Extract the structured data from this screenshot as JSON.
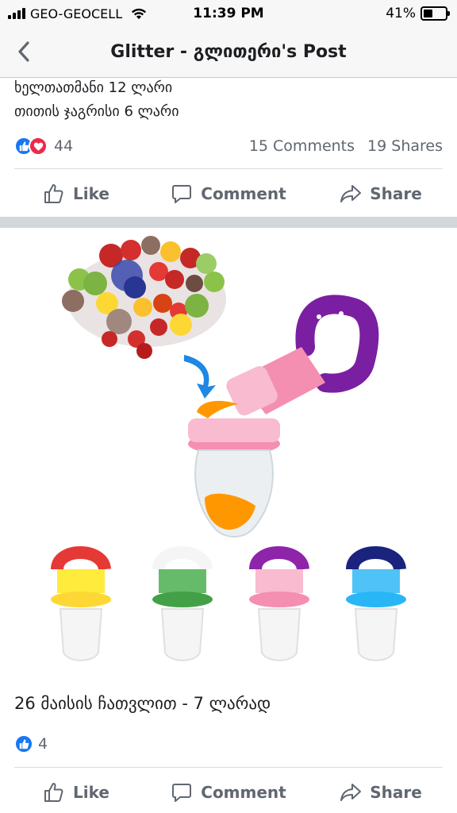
{
  "status_bar": {
    "carrier": "GEO-GEOCELL",
    "time": "11:39 PM",
    "battery_percent": "41%",
    "battery_level": 0.41
  },
  "nav": {
    "title": "Glitter - გლითერი's Post",
    "back_icon": "chevron-left-icon"
  },
  "post": {
    "text_lines": [
      "ხელთათმანი 12 ლარი",
      "თითის ჯაგრისი 6 ლარი"
    ],
    "reactions": {
      "icons": [
        "like-icon",
        "love-icon"
      ],
      "count": "44"
    },
    "comments": "15 Comments",
    "shares": "19 Shares"
  },
  "actions": {
    "like": "Like",
    "comment": "Comment",
    "share": "Share"
  },
  "photo": {
    "description_icon": "baby-fruit-feeder-image",
    "colors": [
      "#e53935",
      "#43a047",
      "#8e24aa",
      "#1e88e5"
    ]
  },
  "photo_post": {
    "caption": "26 მაისის ჩათვლით - 7 ლარად",
    "reactions": {
      "icons": [
        "like-icon"
      ],
      "count": "4"
    }
  },
  "theme": {
    "like_blue": "#1877f2",
    "love_red": "#f0284a",
    "muted_text": "#606770"
  }
}
